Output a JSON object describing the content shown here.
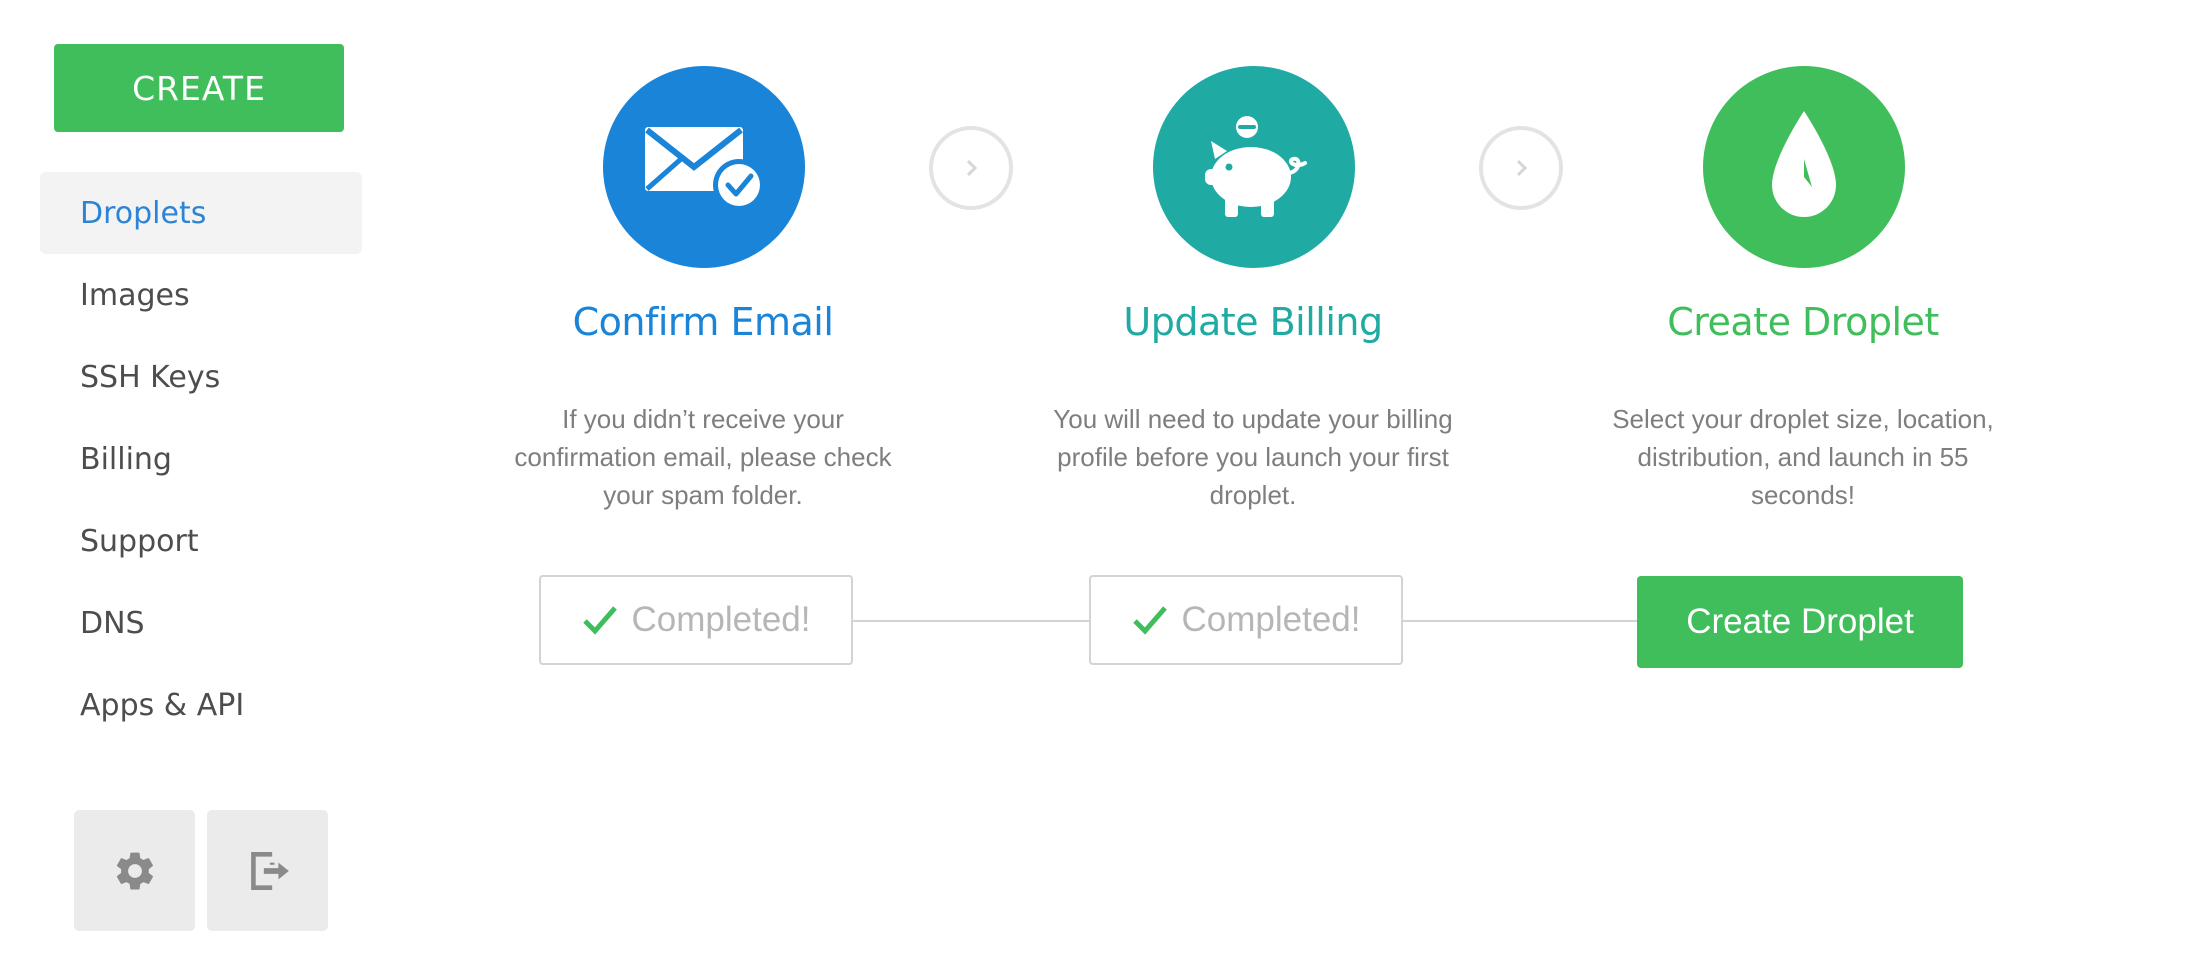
{
  "sidebar": {
    "create_label": "CREATE",
    "items": [
      {
        "label": "Droplets"
      },
      {
        "label": "Images"
      },
      {
        "label": "SSH Keys"
      },
      {
        "label": "Billing"
      },
      {
        "label": "Support"
      },
      {
        "label": "DNS"
      },
      {
        "label": "Apps & API"
      }
    ],
    "active_item": "Droplets",
    "footer_icons": [
      "gear-icon",
      "logout-icon"
    ]
  },
  "steps": [
    {
      "icon": "envelope-check-icon",
      "title": "Confirm Email",
      "description": "If you didn’t receive your confirmation email, please check your spam folder.",
      "status": "Completed!",
      "color": "#1a84d8"
    },
    {
      "icon": "piggy-bank-icon",
      "title": "Update Billing",
      "description": "You will need to update your billing profile before you launch your first droplet.",
      "status": "Completed!",
      "color": "#20aaa4"
    },
    {
      "icon": "droplet-icon",
      "title": "Create Droplet",
      "description": "Select your droplet size, location, distribution, and launch in 55 seconds!",
      "button_label": "Create Droplet",
      "color": "#3fbe5b"
    }
  ],
  "colors": {
    "accent_green": "#3fbe5b",
    "link_blue": "#2c84d6",
    "teal": "#20aaa4",
    "blue": "#1a84d8"
  }
}
